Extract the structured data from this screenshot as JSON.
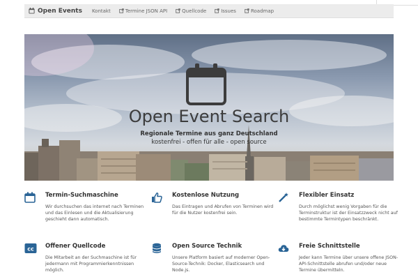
{
  "navbar": {
    "brand": "Open Events",
    "links": [
      {
        "label": "Kontakt",
        "icon": null
      },
      {
        "label": "Termine JSON API",
        "icon": "external-link-icon"
      },
      {
        "label": "Quellcode",
        "icon": "external-link-icon"
      },
      {
        "label": "Issues",
        "icon": "external-link-icon"
      },
      {
        "label": "Roadmap",
        "icon": "external-link-icon"
      }
    ]
  },
  "hero": {
    "title": "Open Event Search",
    "subtitle": "Regionale Termine aus ganz Deutschland",
    "tagline": "kostenfrei - offen für alle - open source"
  },
  "features": [
    {
      "icon": "calendar-icon",
      "title": "Termin-Suchmaschine",
      "text": "Wir durchsuchen das internet nach Terminen und das Einlesen und die Aktualisierung geschieht dann automatisch."
    },
    {
      "icon": "thumbs-up-icon",
      "title": "Kostenlose Nutzung",
      "text": "Das Eintragen und Abrufen von Terminen wird für die Nutzer kostenfrei sein."
    },
    {
      "icon": "magic-wand-icon",
      "title": "Flexibler Einsatz",
      "text": "Durch möglichst wenig Vorgaben für die Terminstruktur ist der Einsatzzweck nicht auf bestimmte Termintypen beschränkt."
    },
    {
      "icon": "cc-icon",
      "title": "Offener Quellcode",
      "text": "Die Mitarbeit an der Suchmaschine ist für jedermann mit Programmierkenntnissen möglich."
    },
    {
      "icon": "database-icon",
      "title": "Open Source Technik",
      "text": "Unsere Platform basiert auf moderner Open-Source-Technik: Docker, Elasticsearch und Node.js."
    },
    {
      "icon": "cloud-download-icon",
      "title": "Freie Schnittstelle",
      "text": "Jeder kann Termine über unsere offene JSON-API-Schnittstelle abrufen und/oder neue Termine übermitteln."
    }
  ],
  "colors": {
    "accent": "#2a6496",
    "navbar_bg": "#ececec"
  }
}
